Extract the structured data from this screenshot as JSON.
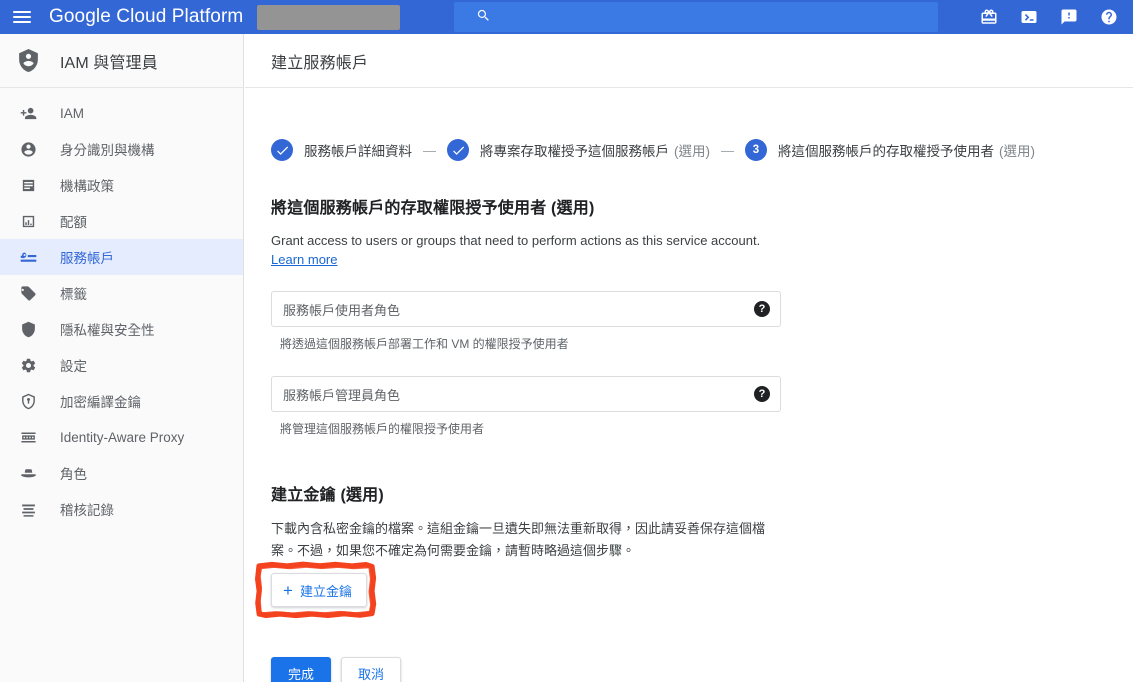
{
  "topbar": {
    "menu_icon": "hamburger-menu-icon",
    "brand": "Google Cloud Platform",
    "project_chip_redacted": true,
    "search": {
      "icon": "search-icon",
      "value": "",
      "placeholder": ""
    },
    "icons": [
      {
        "name": "gift-icon",
        "label": "gift"
      },
      {
        "name": "cloud-shell-icon",
        "label": "cloud-shell"
      },
      {
        "name": "feedback-icon",
        "label": "feedback"
      },
      {
        "name": "help-icon",
        "label": "help"
      }
    ]
  },
  "sidebar": {
    "product_icon": "iam-shield-person-icon",
    "product_title": "IAM 與管理員",
    "items": [
      {
        "label": "IAM",
        "icon": "person-add-icon",
        "active": false
      },
      {
        "label": "身分識別與機構",
        "icon": "account-circle-icon",
        "active": false
      },
      {
        "label": "機構政策",
        "icon": "policy-document-icon",
        "active": false
      },
      {
        "label": "配額",
        "icon": "quota-chart-icon",
        "active": false
      },
      {
        "label": "服務帳戶",
        "icon": "key-account-icon",
        "active": true
      },
      {
        "label": "標籤",
        "icon": "label-tag-icon",
        "active": false
      },
      {
        "label": "隱私權與安全性",
        "icon": "shield-icon",
        "active": false
      },
      {
        "label": "設定",
        "icon": "gear-icon",
        "active": false
      },
      {
        "label": "加密編譯金鑰",
        "icon": "shield-key-icon",
        "active": false
      },
      {
        "label": "Identity-Aware Proxy",
        "icon": "proxy-icon",
        "active": false
      },
      {
        "label": "角色",
        "icon": "roles-hat-icon",
        "active": false
      },
      {
        "label": "稽核記錄",
        "icon": "audit-log-lines-icon",
        "active": false
      }
    ]
  },
  "page": {
    "title": "建立服務帳戶"
  },
  "stepper": {
    "separator": "—",
    "steps": [
      {
        "badge": "check",
        "number": "1",
        "label": "服務帳戶詳細資料",
        "optional": "",
        "state": "complete"
      },
      {
        "badge": "check",
        "number": "2",
        "label": "將專案存取權授予這個服務帳戶",
        "optional": "(選用)",
        "state": "complete"
      },
      {
        "badge": "number",
        "number": "3",
        "label": "將這個服務帳戶的存取權授予使用者",
        "optional": "(選用)",
        "state": "current"
      }
    ]
  },
  "access_section": {
    "title": "將這個服務帳戶的存取權限授予使用者 (選用)",
    "description": "Grant access to users or groups that need to perform actions as this service account.",
    "learn_more": "Learn more",
    "fields": [
      {
        "placeholder": "服務帳戶使用者角色",
        "value": "",
        "hint": "將透過這個服務帳戶部署工作和 VM 的權限授予使用者",
        "help_glyph": "?"
      },
      {
        "placeholder": "服務帳戶管理員角色",
        "value": "",
        "hint": "將管理這個服務帳戶的權限授予使用者",
        "help_glyph": "?"
      }
    ]
  },
  "key_section": {
    "title": "建立金鑰 (選用)",
    "description": "下載內含私密金鑰的檔案。這組金鑰一旦遺失即無法重新取得，因此請妥善保存這個檔案。不過，如果您不確定為何需要金鑰，請暫時略過這個步驟。",
    "button_plus": "+",
    "button_label": "建立金鑰",
    "annotation": {
      "shape": "hand-drawn-rectangle",
      "color": "#f4421e"
    }
  },
  "actions": {
    "primary_label": "完成",
    "secondary_label": "取消"
  },
  "colors": {
    "topbar_blue": "#3367d6",
    "search_blue": "#3b7ae4",
    "accent_blue": "#1a73e8",
    "link_blue": "#1967d2",
    "active_nav_bg": "#e4ecfd",
    "annotation_red": "#f4421e",
    "sidebar_bg": "#fafafa",
    "text_primary": "#3c4043",
    "text_secondary": "#5f6368"
  }
}
